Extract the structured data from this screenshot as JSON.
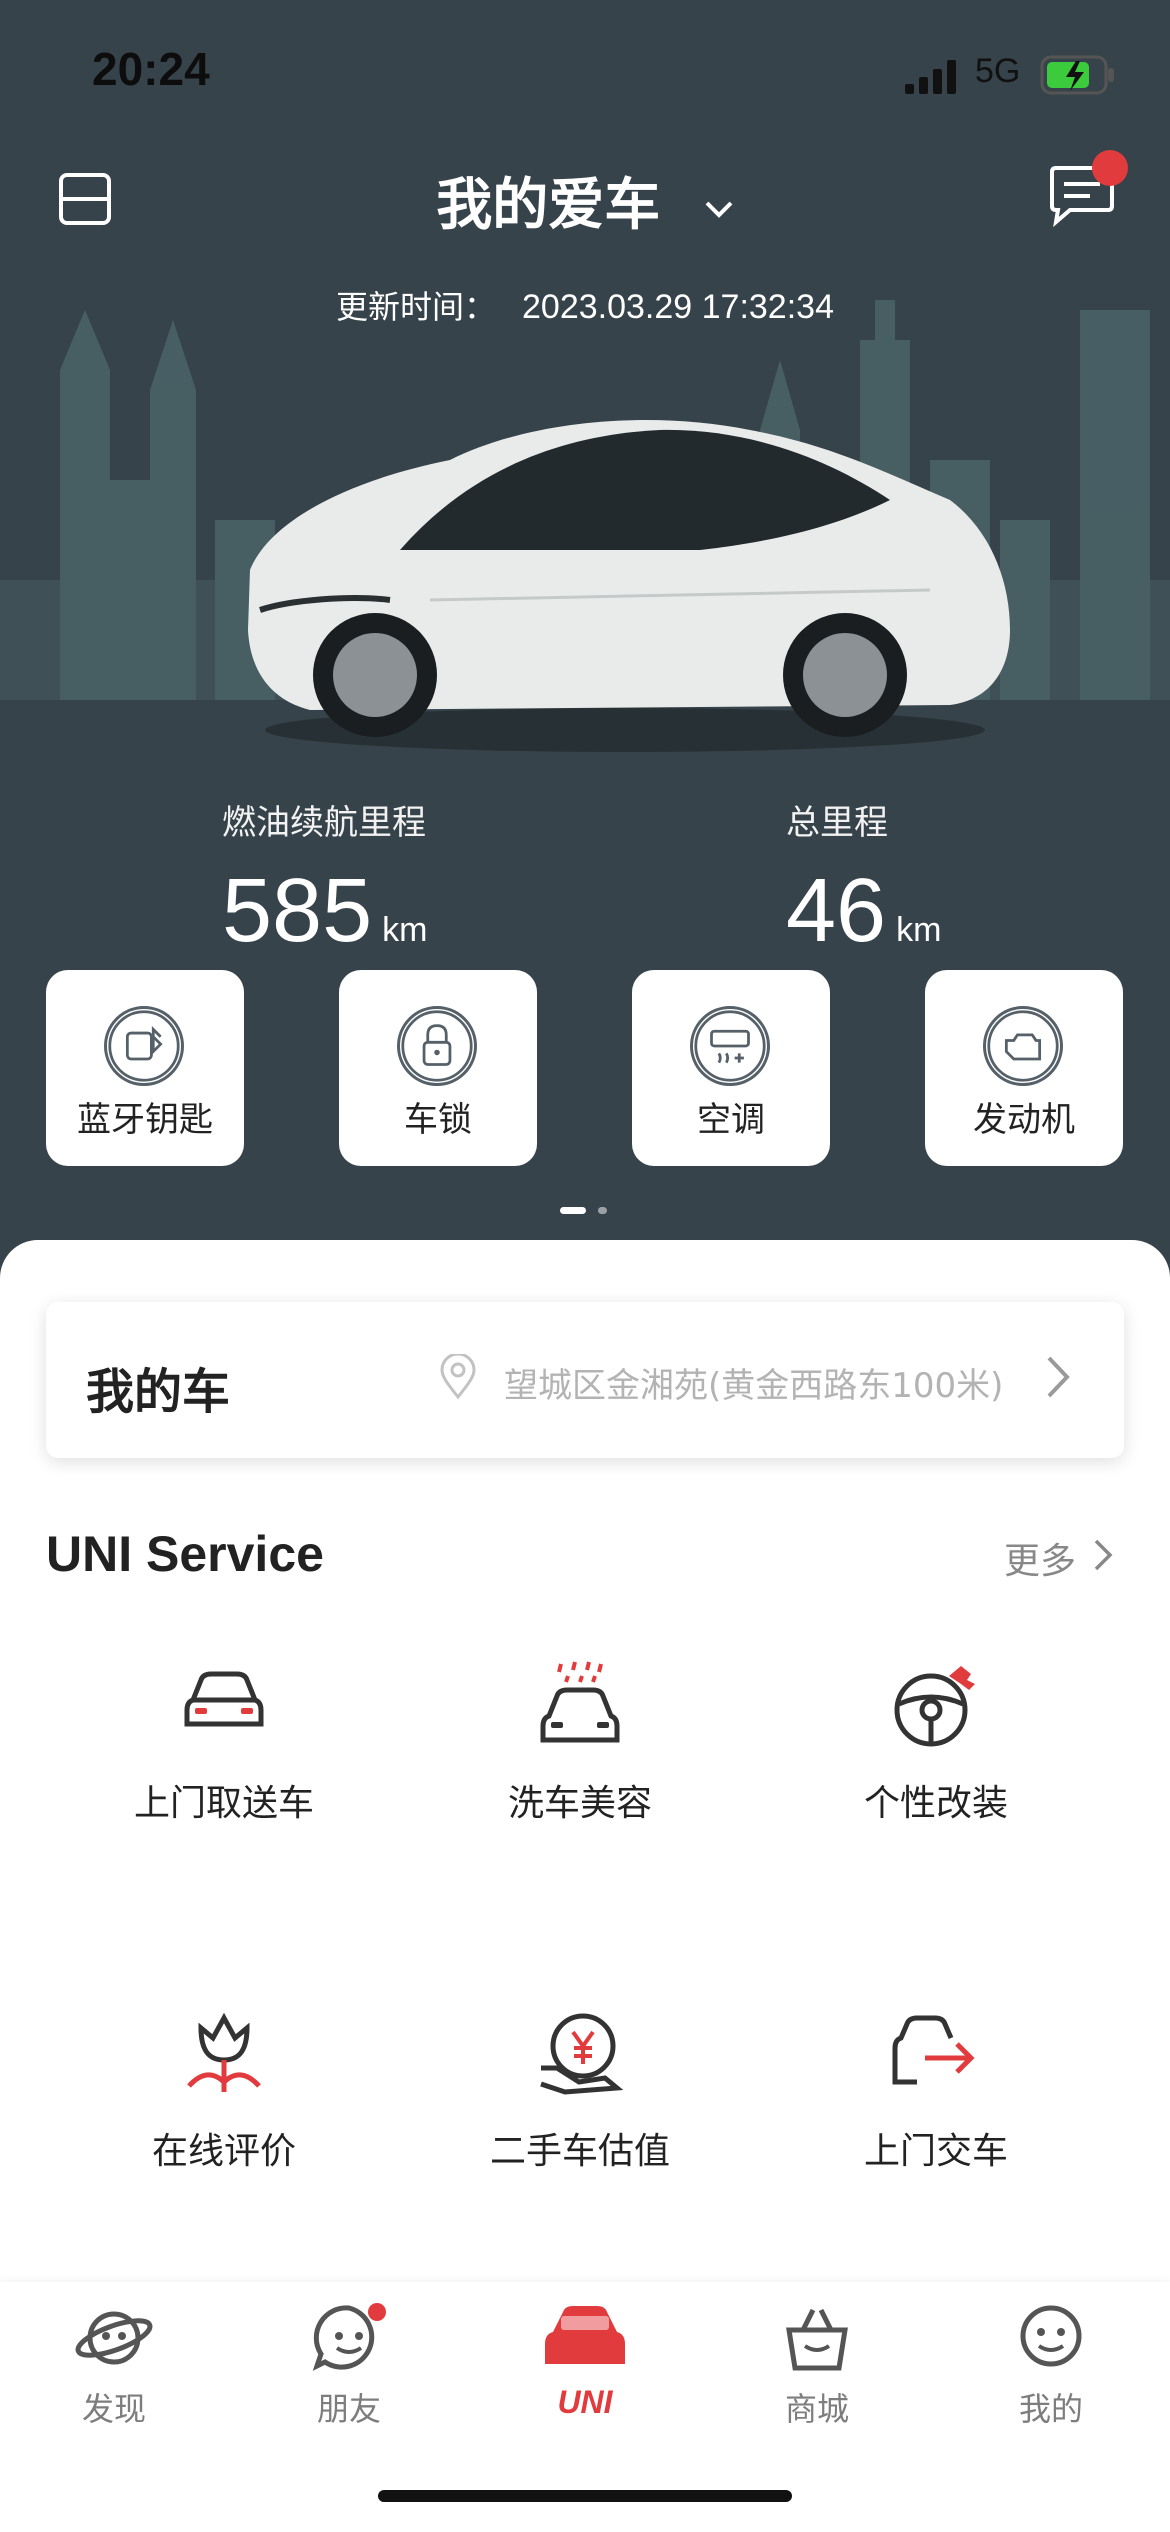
{
  "status_bar": {
    "time": "20:24",
    "network": "5G"
  },
  "header": {
    "title": "我的爱车",
    "update_label": "更新时间：",
    "update_value": "2023.03.29 17:32:34"
  },
  "stats": [
    {
      "label": "燃油续航里程",
      "value": "585",
      "unit": "km"
    },
    {
      "label": "总里程",
      "value": "46",
      "unit": "km"
    }
  ],
  "controls": [
    {
      "label": "蓝牙钥匙",
      "icon": "bluetooth-key-icon"
    },
    {
      "label": "车锁",
      "icon": "lock-icon"
    },
    {
      "label": "空调",
      "icon": "air-conditioner-icon"
    },
    {
      "label": "发动机",
      "icon": "engine-icon"
    }
  ],
  "my_car": {
    "title": "我的车",
    "location": "望城区金湘苑(黄金西路东100米)"
  },
  "services": {
    "title": "UNI Service",
    "more_label": "更多",
    "items": [
      {
        "label": "上门取送车",
        "icon": "car-pickup-icon"
      },
      {
        "label": "洗车美容",
        "icon": "car-wash-icon"
      },
      {
        "label": "个性改装",
        "icon": "steering-wheel-wrench-icon"
      },
      {
        "label": "在线评价",
        "icon": "tulip-icon"
      },
      {
        "label": "二手车估值",
        "icon": "yuan-hand-icon"
      },
      {
        "label": "上门交车",
        "icon": "car-delivery-icon"
      }
    ]
  },
  "tabs": [
    {
      "label": "发现",
      "icon": "planet-icon"
    },
    {
      "label": "朋友",
      "icon": "chat-face-icon"
    },
    {
      "label": "UNI",
      "icon": "uni-car-icon"
    },
    {
      "label": "商城",
      "icon": "shopping-bag-icon"
    },
    {
      "label": "我的",
      "icon": "profile-face-icon"
    }
  ],
  "colors": {
    "hero_bg": "#37434a",
    "accent_red": "#e23b3e",
    "icon_dark": "#333333"
  }
}
